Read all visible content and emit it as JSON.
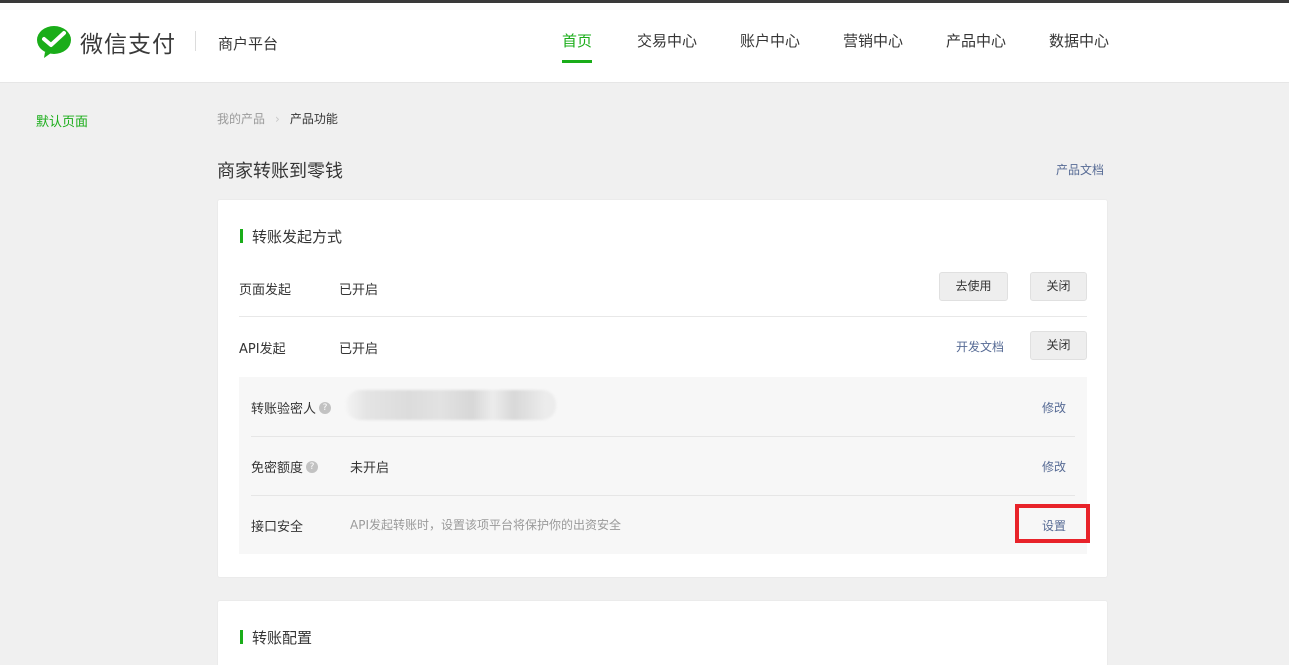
{
  "brand": {
    "logo_text": "微信支付",
    "platform": "商户平台"
  },
  "nav": [
    "首页",
    "交易中心",
    "账户中心",
    "营销中心",
    "产品中心",
    "数据中心"
  ],
  "sidebar": {
    "item": "默认页面"
  },
  "breadcrumb": {
    "parent": "我的产品",
    "current": "产品功能"
  },
  "page": {
    "title": "商家转账到零钱",
    "doc_link": "产品文档"
  },
  "section1": {
    "title": "转账发起方式",
    "page_row": {
      "label": "页面发起",
      "status": "已开启",
      "use_button": "去使用",
      "close_button": "关闭"
    },
    "api_row": {
      "label": "API发起",
      "status": "已开启",
      "doc_link": "开发文档",
      "close_button": "关闭"
    },
    "verifier": {
      "label": "转账验密人",
      "edit": "修改"
    },
    "free_limit": {
      "label": "免密额度",
      "status": "未开启",
      "edit": "修改"
    },
    "api_security": {
      "label": "接口安全",
      "hint": "API发起转账时，设置该项平台将保护你的出资安全",
      "setting": "设置"
    }
  },
  "section2": {
    "title": "转账配置"
  },
  "colors": {
    "accent": "#1aad19",
    "link": "#576b95",
    "highlight": "#e8232a"
  },
  "icons": [
    "wechat-pay-logo-icon",
    "chevron-right-icon",
    "help-icon"
  ]
}
